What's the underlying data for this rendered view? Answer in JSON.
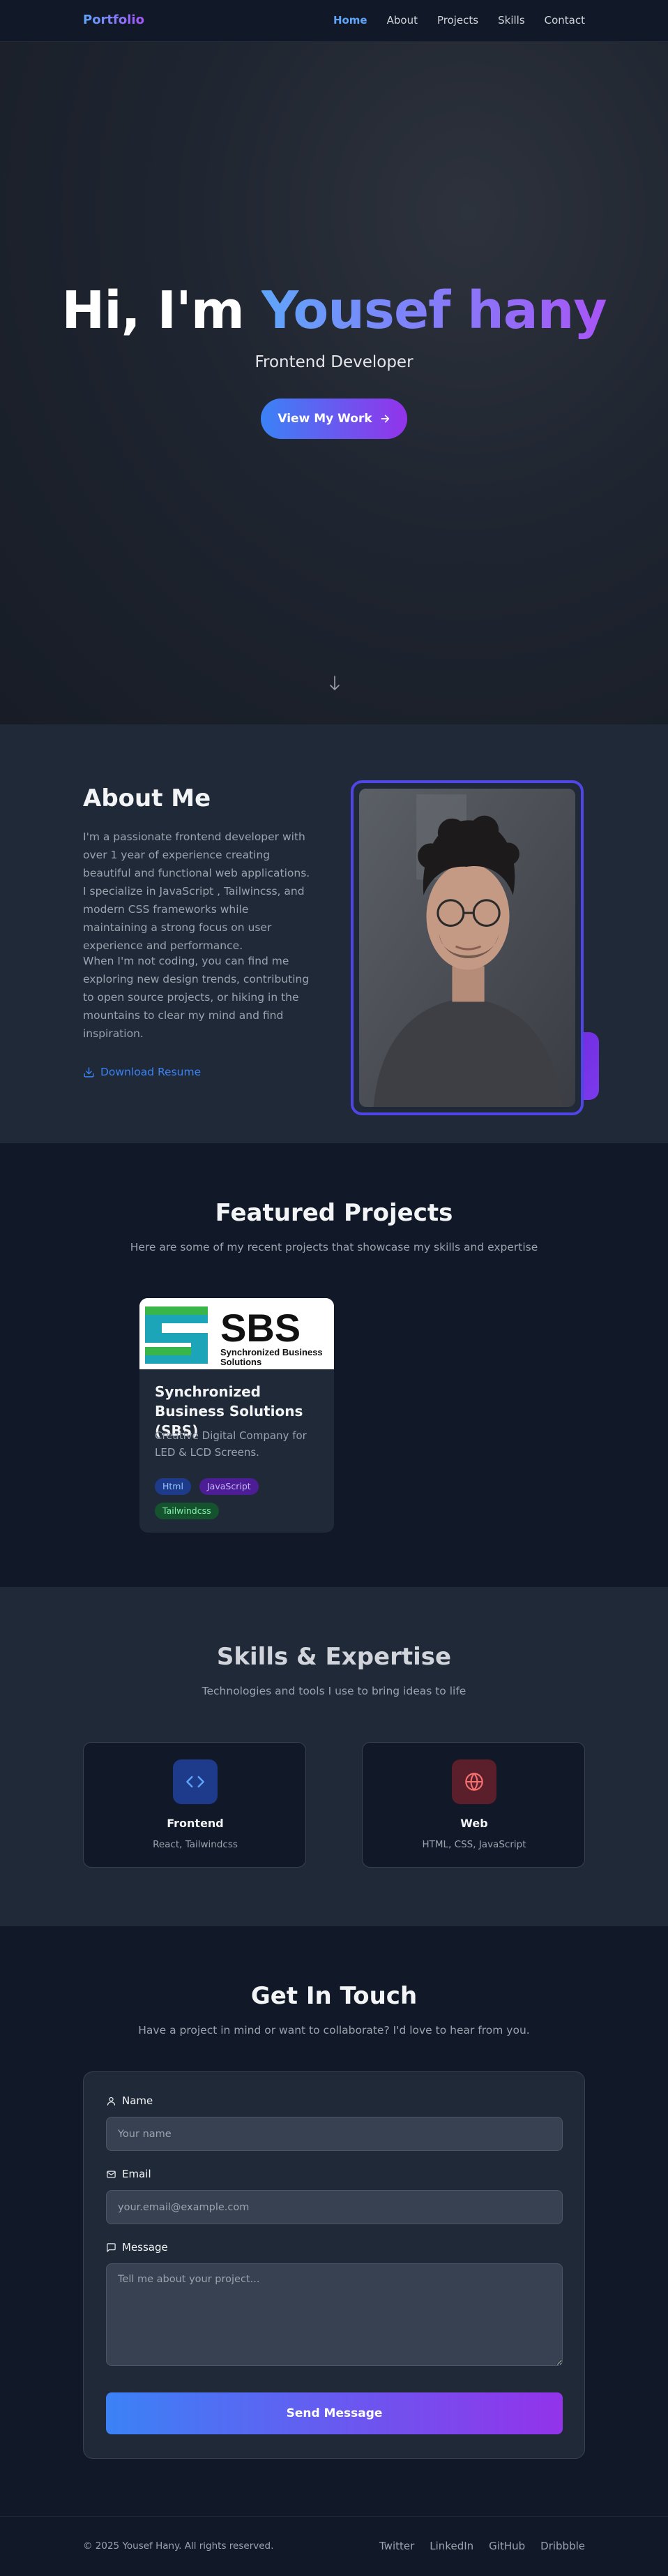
{
  "nav": {
    "logo": "Portfolio",
    "links": [
      {
        "label": "Home",
        "active": true
      },
      {
        "label": "About",
        "active": false
      },
      {
        "label": "Projects",
        "active": false
      },
      {
        "label": "Skills",
        "active": false
      },
      {
        "label": "Contact",
        "active": false
      }
    ]
  },
  "hero": {
    "greeting": "Hi, I'm",
    "name": "Yousef hany",
    "subtitle": "Frontend Developer",
    "cta_label": "View My Work",
    "cta_icon": "arrow-right-icon",
    "scroll_icon": "arrow-down-icon"
  },
  "about": {
    "title": "About Me",
    "paragraph1": "I'm a passionate frontend developer with over 1 year of experience creating beautiful and functional web applications. I specialize in JavaScript , Tailwincss, and modern CSS frameworks while maintaining a strong focus on user experience and performance.",
    "paragraph2": "When I'm not coding, you can find me exploring new design trends, contributing to open source projects, or hiking in the mountains to clear my mind and find inspiration.",
    "resume_label": "Download Resume",
    "resume_icon": "download-icon"
  },
  "projects": {
    "title": "Featured Projects",
    "subtitle": "Here are some of my recent projects that showcase my skills and expertise",
    "items": [
      {
        "logo_text": "SBS",
        "logo_line1": "Synchronized Business",
        "logo_line2": "Solutions",
        "title": "Synchronized Business Solutions (SBS)",
        "description": "Creative Digital Company for LED & LCD Screens.",
        "tags": [
          "Html",
          "JavaScript",
          "Tailwindcss"
        ]
      }
    ]
  },
  "skills": {
    "title": "Skills & Expertise",
    "subtitle": "Technologies and tools I use to bring ideas to life",
    "items": [
      {
        "name": "Frontend",
        "description": "React, Tailwindcss",
        "icon": "code-icon"
      },
      {
        "name": "Web",
        "description": "HTML, CSS, JavaScript",
        "icon": "globe-icon"
      }
    ]
  },
  "contact": {
    "title": "Get In Touch",
    "subtitle": "Have a project in mind or want to collaborate? I'd love to hear from you.",
    "name_label": "Name",
    "name_placeholder": "Your name",
    "email_label": "Email",
    "email_placeholder": "your.email@example.com",
    "message_label": "Message",
    "message_placeholder": "Tell me about your project...",
    "submit_label": "Send Message"
  },
  "footer": {
    "copyright": "© 2025 Yousef Hany. All rights reserved.",
    "links": [
      "Twitter",
      "LinkedIn",
      "GitHub",
      "Dribbble"
    ]
  },
  "colors": {
    "accent_blue": "#3b82f6",
    "accent_purple": "#9333ea",
    "background": "#111827",
    "surface": "#1f2937"
  }
}
